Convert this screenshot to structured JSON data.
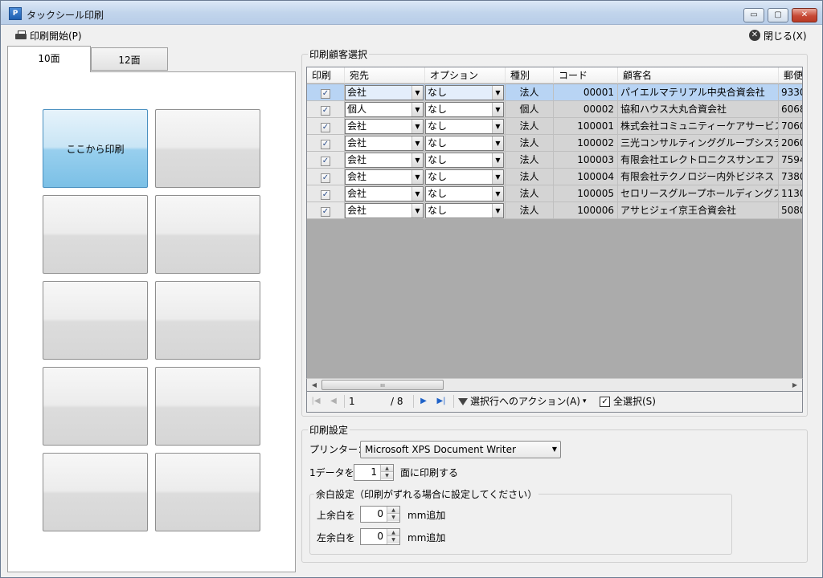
{
  "window": {
    "title": "タックシール印刷",
    "app_icon": "P",
    "buttons": {
      "minimize": "▭",
      "maximize": "▢",
      "close": "✕"
    }
  },
  "toolbar": {
    "print_label": "印刷開始(P)",
    "close_label": "閉じる(X)"
  },
  "tabs": [
    {
      "label": "10面",
      "active": true
    },
    {
      "label": "12面",
      "active": false
    }
  ],
  "label_sheet": {
    "start_label": "ここから印刷",
    "cell_count": 10,
    "selected_index": 0
  },
  "customers": {
    "group_title": "印刷顧客選択",
    "columns": [
      "印刷",
      "宛先",
      "オプション",
      "種別",
      "コード",
      "顧客名",
      "郵便"
    ],
    "rows": [
      {
        "print": true,
        "to": "会社",
        "option": "なし",
        "kind": "法人",
        "code": "00001",
        "name": "パイエルマテリアル中央合資会社",
        "zip": "9330"
      },
      {
        "print": true,
        "to": "個人",
        "option": "なし",
        "kind": "個人",
        "code": "00002",
        "name": "協和ハウス大丸合資会社",
        "zip": "6068"
      },
      {
        "print": true,
        "to": "会社",
        "option": "なし",
        "kind": "法人",
        "code": "100001",
        "name": "株式会社コミュニティーケアサービスコン...",
        "zip": "7060"
      },
      {
        "print": true,
        "to": "会社",
        "option": "なし",
        "kind": "法人",
        "code": "100002",
        "name": "三光コンサルティンググループシステム...",
        "zip": "2060"
      },
      {
        "print": true,
        "to": "会社",
        "option": "なし",
        "kind": "法人",
        "code": "100003",
        "name": "有限会社エレクトロニクスサンエフ",
        "zip": "7594"
      },
      {
        "print": true,
        "to": "会社",
        "option": "なし",
        "kind": "法人",
        "code": "100004",
        "name": "有限会社テクノロジー内外ビジネス",
        "zip": "7380"
      },
      {
        "print": true,
        "to": "会社",
        "option": "なし",
        "kind": "法人",
        "code": "100005",
        "name": "セロリースグループホールディングス合...",
        "zip": "1130"
      },
      {
        "print": true,
        "to": "会社",
        "option": "なし",
        "kind": "法人",
        "code": "100006",
        "name": "アサヒジェイ京王合資会社",
        "zip": "5080"
      }
    ],
    "selected_row": 0,
    "scroll_grip": "ııı"
  },
  "navigator": {
    "first": "|◀",
    "prev": "◀",
    "page": "1",
    "total": "/ 8",
    "next": "▶",
    "last": "▶|",
    "action_label": "選択行へのアクション(A)",
    "action_arrow": "▾",
    "select_all_label": "全選択(S)",
    "select_all_checked": true
  },
  "print_settings": {
    "group_title": "印刷設定",
    "printer_label": "プリンター：",
    "printer_value": "Microsoft XPS Document Writer",
    "per_data_label": "1データを",
    "per_data_value": "1",
    "per_data_suffix": "面に印刷する",
    "margin_group_title": "余白設定（印刷がずれる場合に設定してください）",
    "top_margin_label": "上余白を",
    "top_margin_value": "0",
    "top_margin_suffix": "mm追加",
    "left_margin_label": "左余白を",
    "left_margin_value": "0",
    "left_margin_suffix": "mm追加"
  },
  "icons": {
    "printer": "printer-icon",
    "close_circle": "close-circle-icon",
    "filter": "filter-icon",
    "check": "✓",
    "dropdown_arrow": "▼",
    "spin_up": "▲",
    "spin_down": "▼",
    "scroll_left": "◀",
    "scroll_right": "▶"
  },
  "colors": {
    "selected_row": "#b8d4f4",
    "selected_cell": "#7bc0e6",
    "nav_enabled": "#1f62c8"
  }
}
